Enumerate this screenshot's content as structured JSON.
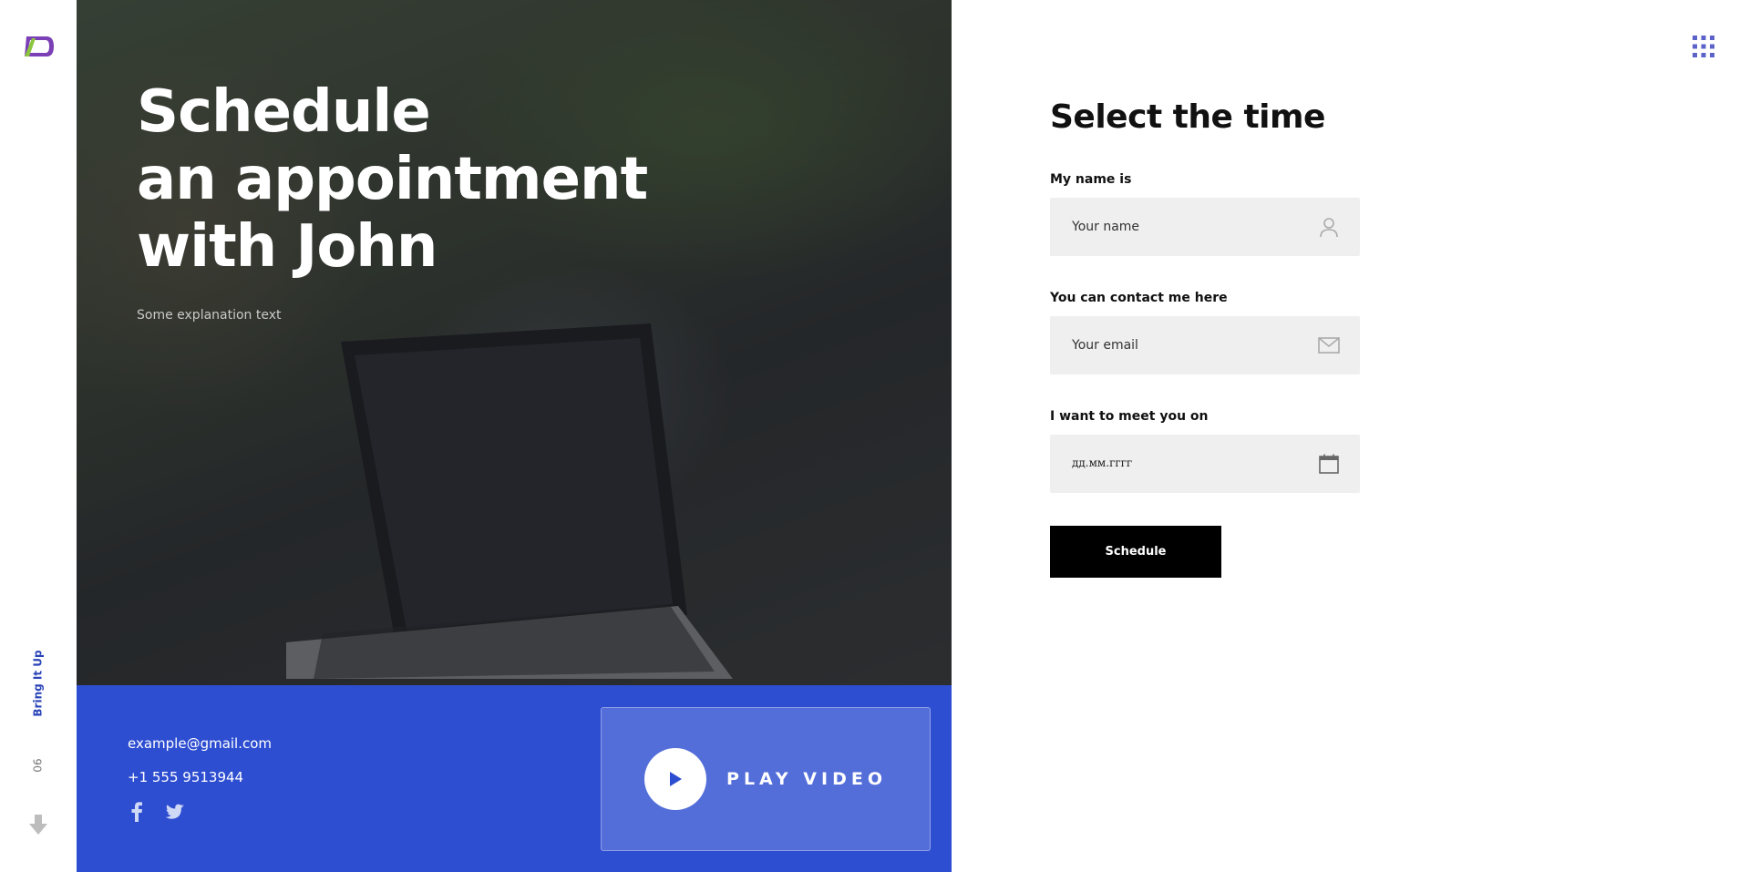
{
  "sidebar": {
    "logo_icon": "logo-icon",
    "vertical_label": "Bring It Up",
    "page_number": "06",
    "scroll_icon": "arrow-down-icon",
    "accent_color": "#2a44b8"
  },
  "hero": {
    "title_line1": "Schedule",
    "title_line2": "an appointment",
    "title_line3": "with John",
    "subtitle": "Some explanation text"
  },
  "contact": {
    "email": "example@gmail.com",
    "phone": "+1 555 9513944",
    "social": [
      "facebook-icon",
      "twitter-icon"
    ],
    "band_color": "#2e4ed1"
  },
  "video": {
    "label": "PLAY VIDEO",
    "icon": "play-icon"
  },
  "header": {
    "menu_icon": "grid-menu-icon"
  },
  "form": {
    "title": "Select the time",
    "name_label": "My name is",
    "name_placeholder": "Your name",
    "name_icon": "user-icon",
    "email_label": "You can contact me here",
    "email_placeholder": "Your email",
    "email_icon": "mail-icon",
    "date_label": "I want to meet you on",
    "date_placeholder": "дд.мм.гггг",
    "date_icon": "calendar-icon",
    "submit_label": "Schedule"
  }
}
